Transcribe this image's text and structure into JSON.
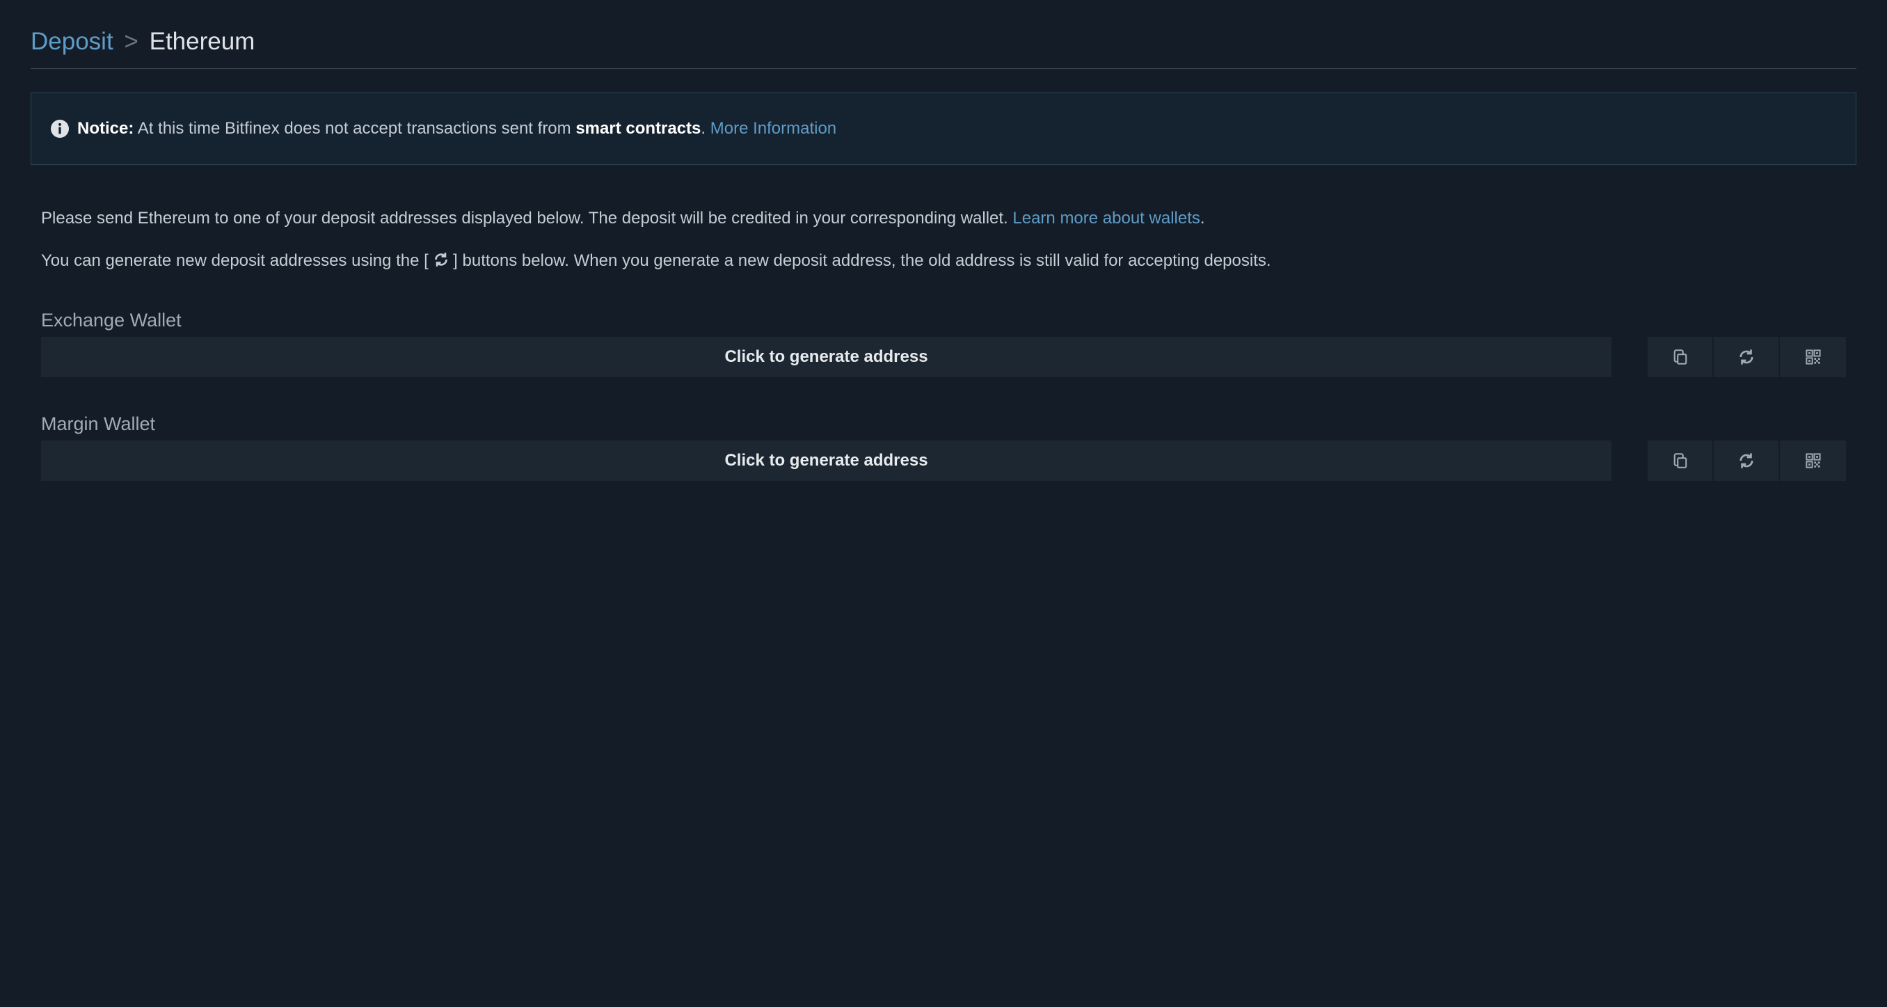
{
  "breadcrumb": {
    "deposit": "Deposit",
    "separator": ">",
    "asset": "Ethereum"
  },
  "notice": {
    "label": "Notice:",
    "text_before": " At this time Bitfinex does not accept transactions sent from ",
    "text_bold": "smart contracts",
    "text_after": ". ",
    "link": "More Information"
  },
  "intro": {
    "para1_before": "Please send Ethereum to one of your deposit addresses displayed below. The deposit will be credited in your corresponding wallet. ",
    "para1_link": "Learn more about wallets",
    "para1_after": ".",
    "para2_before": "You can generate new deposit addresses using the [ ",
    "para2_after": " ] buttons below. When you generate a new deposit address, the old address is still valid for accepting deposits."
  },
  "wallets": [
    {
      "title": "Exchange Wallet",
      "button": "Click to generate address"
    },
    {
      "title": "Margin Wallet",
      "button": "Click to generate address"
    }
  ]
}
